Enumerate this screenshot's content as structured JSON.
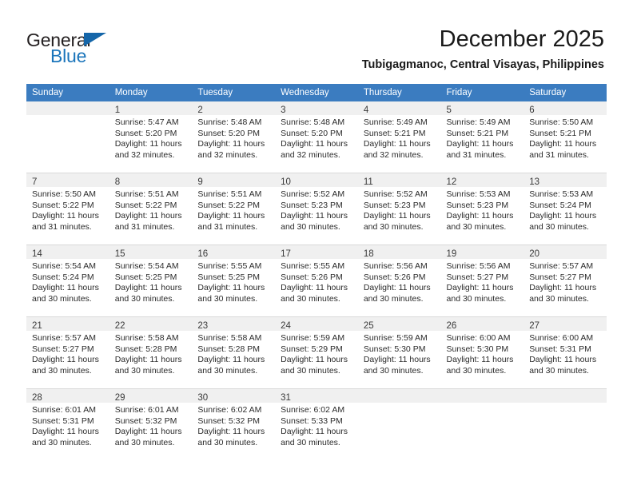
{
  "brand": {
    "name_top": "General",
    "name_bottom": "Blue",
    "triangle_color": "#1566a9",
    "blue_color": "#1b75bb"
  },
  "header": {
    "title": "December 2025",
    "subtitle": "Tubigagmanoc, Central Visayas, Philippines"
  },
  "theme": {
    "header_row_bg": "#3b7cc0",
    "header_row_text": "#ffffff",
    "daynum_bg": "#f0f0f0",
    "grid_line": "#d9d9d9"
  },
  "weekdays": [
    "Sunday",
    "Monday",
    "Tuesday",
    "Wednesday",
    "Thursday",
    "Friday",
    "Saturday"
  ],
  "weeks": [
    [
      {
        "day": ""
      },
      {
        "day": "1",
        "sunrise": "Sunrise: 5:47 AM",
        "sunset": "Sunset: 5:20 PM",
        "daylight1": "Daylight: 11 hours",
        "daylight2": "and 32 minutes."
      },
      {
        "day": "2",
        "sunrise": "Sunrise: 5:48 AM",
        "sunset": "Sunset: 5:20 PM",
        "daylight1": "Daylight: 11 hours",
        "daylight2": "and 32 minutes."
      },
      {
        "day": "3",
        "sunrise": "Sunrise: 5:48 AM",
        "sunset": "Sunset: 5:20 PM",
        "daylight1": "Daylight: 11 hours",
        "daylight2": "and 32 minutes."
      },
      {
        "day": "4",
        "sunrise": "Sunrise: 5:49 AM",
        "sunset": "Sunset: 5:21 PM",
        "daylight1": "Daylight: 11 hours",
        "daylight2": "and 32 minutes."
      },
      {
        "day": "5",
        "sunrise": "Sunrise: 5:49 AM",
        "sunset": "Sunset: 5:21 PM",
        "daylight1": "Daylight: 11 hours",
        "daylight2": "and 31 minutes."
      },
      {
        "day": "6",
        "sunrise": "Sunrise: 5:50 AM",
        "sunset": "Sunset: 5:21 PM",
        "daylight1": "Daylight: 11 hours",
        "daylight2": "and 31 minutes."
      }
    ],
    [
      {
        "day": "7",
        "sunrise": "Sunrise: 5:50 AM",
        "sunset": "Sunset: 5:22 PM",
        "daylight1": "Daylight: 11 hours",
        "daylight2": "and 31 minutes."
      },
      {
        "day": "8",
        "sunrise": "Sunrise: 5:51 AM",
        "sunset": "Sunset: 5:22 PM",
        "daylight1": "Daylight: 11 hours",
        "daylight2": "and 31 minutes."
      },
      {
        "day": "9",
        "sunrise": "Sunrise: 5:51 AM",
        "sunset": "Sunset: 5:22 PM",
        "daylight1": "Daylight: 11 hours",
        "daylight2": "and 31 minutes."
      },
      {
        "day": "10",
        "sunrise": "Sunrise: 5:52 AM",
        "sunset": "Sunset: 5:23 PM",
        "daylight1": "Daylight: 11 hours",
        "daylight2": "and 30 minutes."
      },
      {
        "day": "11",
        "sunrise": "Sunrise: 5:52 AM",
        "sunset": "Sunset: 5:23 PM",
        "daylight1": "Daylight: 11 hours",
        "daylight2": "and 30 minutes."
      },
      {
        "day": "12",
        "sunrise": "Sunrise: 5:53 AM",
        "sunset": "Sunset: 5:23 PM",
        "daylight1": "Daylight: 11 hours",
        "daylight2": "and 30 minutes."
      },
      {
        "day": "13",
        "sunrise": "Sunrise: 5:53 AM",
        "sunset": "Sunset: 5:24 PM",
        "daylight1": "Daylight: 11 hours",
        "daylight2": "and 30 minutes."
      }
    ],
    [
      {
        "day": "14",
        "sunrise": "Sunrise: 5:54 AM",
        "sunset": "Sunset: 5:24 PM",
        "daylight1": "Daylight: 11 hours",
        "daylight2": "and 30 minutes."
      },
      {
        "day": "15",
        "sunrise": "Sunrise: 5:54 AM",
        "sunset": "Sunset: 5:25 PM",
        "daylight1": "Daylight: 11 hours",
        "daylight2": "and 30 minutes."
      },
      {
        "day": "16",
        "sunrise": "Sunrise: 5:55 AM",
        "sunset": "Sunset: 5:25 PM",
        "daylight1": "Daylight: 11 hours",
        "daylight2": "and 30 minutes."
      },
      {
        "day": "17",
        "sunrise": "Sunrise: 5:55 AM",
        "sunset": "Sunset: 5:26 PM",
        "daylight1": "Daylight: 11 hours",
        "daylight2": "and 30 minutes."
      },
      {
        "day": "18",
        "sunrise": "Sunrise: 5:56 AM",
        "sunset": "Sunset: 5:26 PM",
        "daylight1": "Daylight: 11 hours",
        "daylight2": "and 30 minutes."
      },
      {
        "day": "19",
        "sunrise": "Sunrise: 5:56 AM",
        "sunset": "Sunset: 5:27 PM",
        "daylight1": "Daylight: 11 hours",
        "daylight2": "and 30 minutes."
      },
      {
        "day": "20",
        "sunrise": "Sunrise: 5:57 AM",
        "sunset": "Sunset: 5:27 PM",
        "daylight1": "Daylight: 11 hours",
        "daylight2": "and 30 minutes."
      }
    ],
    [
      {
        "day": "21",
        "sunrise": "Sunrise: 5:57 AM",
        "sunset": "Sunset: 5:27 PM",
        "daylight1": "Daylight: 11 hours",
        "daylight2": "and 30 minutes."
      },
      {
        "day": "22",
        "sunrise": "Sunrise: 5:58 AM",
        "sunset": "Sunset: 5:28 PM",
        "daylight1": "Daylight: 11 hours",
        "daylight2": "and 30 minutes."
      },
      {
        "day": "23",
        "sunrise": "Sunrise: 5:58 AM",
        "sunset": "Sunset: 5:28 PM",
        "daylight1": "Daylight: 11 hours",
        "daylight2": "and 30 minutes."
      },
      {
        "day": "24",
        "sunrise": "Sunrise: 5:59 AM",
        "sunset": "Sunset: 5:29 PM",
        "daylight1": "Daylight: 11 hours",
        "daylight2": "and 30 minutes."
      },
      {
        "day": "25",
        "sunrise": "Sunrise: 5:59 AM",
        "sunset": "Sunset: 5:30 PM",
        "daylight1": "Daylight: 11 hours",
        "daylight2": "and 30 minutes."
      },
      {
        "day": "26",
        "sunrise": "Sunrise: 6:00 AM",
        "sunset": "Sunset: 5:30 PM",
        "daylight1": "Daylight: 11 hours",
        "daylight2": "and 30 minutes."
      },
      {
        "day": "27",
        "sunrise": "Sunrise: 6:00 AM",
        "sunset": "Sunset: 5:31 PM",
        "daylight1": "Daylight: 11 hours",
        "daylight2": "and 30 minutes."
      }
    ],
    [
      {
        "day": "28",
        "sunrise": "Sunrise: 6:01 AM",
        "sunset": "Sunset: 5:31 PM",
        "daylight1": "Daylight: 11 hours",
        "daylight2": "and 30 minutes."
      },
      {
        "day": "29",
        "sunrise": "Sunrise: 6:01 AM",
        "sunset": "Sunset: 5:32 PM",
        "daylight1": "Daylight: 11 hours",
        "daylight2": "and 30 minutes."
      },
      {
        "day": "30",
        "sunrise": "Sunrise: 6:02 AM",
        "sunset": "Sunset: 5:32 PM",
        "daylight1": "Daylight: 11 hours",
        "daylight2": "and 30 minutes."
      },
      {
        "day": "31",
        "sunrise": "Sunrise: 6:02 AM",
        "sunset": "Sunset: 5:33 PM",
        "daylight1": "Daylight: 11 hours",
        "daylight2": "and 30 minutes."
      },
      {
        "day": ""
      },
      {
        "day": ""
      },
      {
        "day": ""
      }
    ]
  ]
}
